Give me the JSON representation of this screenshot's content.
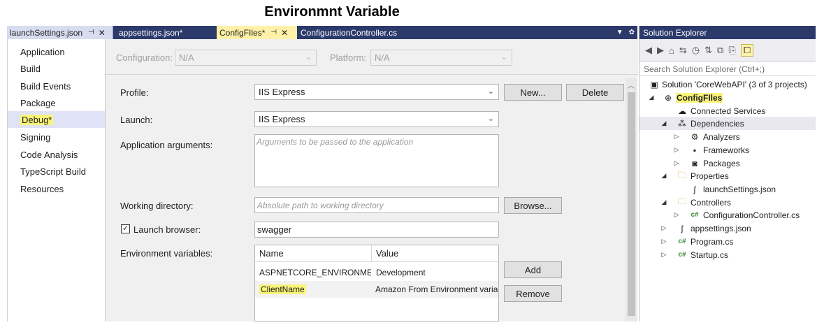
{
  "page_title": "Environmnt Variable",
  "tabs": [
    {
      "label": "launchSettings.json",
      "pin": "⊣",
      "close": "✕"
    },
    {
      "label": "appsettings.json*"
    },
    {
      "label": "ConfigFIles*",
      "pin": "⊣",
      "close": "✕"
    },
    {
      "label": "ConfigurationController.cs"
    }
  ],
  "tab_controls": {
    "dropdown": "▼",
    "gear": "✿"
  },
  "left_nav": [
    "Application",
    "Build",
    "Build Events",
    "Package",
    "Debug*",
    "Signing",
    "Code Analysis",
    "TypeScript Build",
    "Resources"
  ],
  "config": {
    "configuration_label": "Configuration:",
    "configuration_value": "N/A",
    "platform_label": "Platform:",
    "platform_value": "N/A"
  },
  "debug": {
    "profile_label": "Profile:",
    "profile_value": "IIS Express",
    "new_button": "New...",
    "delete_button": "Delete",
    "launch_label": "Launch:",
    "launch_value": "IIS Express",
    "app_args_label": "Application arguments:",
    "app_args_placeholder": "Arguments to be passed to the application",
    "working_dir_label": "Working directory:",
    "working_dir_placeholder": "Absolute path to working directory",
    "browse_button": "Browse...",
    "launch_browser_label": "Launch browser:",
    "launch_browser_checked": "✓",
    "launch_browser_value": "swagger",
    "env_label": "Environment variables:",
    "env_headers": [
      "Name",
      "Value"
    ],
    "env_rows": [
      {
        "name": "ASPNETCORE_ENVIRONMENT",
        "value": "Development"
      },
      {
        "name": "ClientName",
        "value": "Amazon From Environment variable"
      }
    ],
    "add_button": "Add",
    "remove_button": "Remove"
  },
  "solution_explorer": {
    "title": "Solution Explorer",
    "search_placeholder": "Search Solution Explorer (Ctrl+;)",
    "toolbar_icons": [
      "◀",
      "▶",
      "⌂",
      "⇆",
      "◷",
      "⇅",
      "⧉",
      "⎘",
      "⧠"
    ],
    "tree": [
      {
        "label": "Solution 'CoreWebAPI' (3 of 3 projects)",
        "expander": "",
        "icon": "▣"
      },
      {
        "label": "ConfigFIles",
        "expander": "◢",
        "icon": "⊕"
      },
      {
        "label": "Connected Services",
        "expander": "",
        "icon": "☁"
      },
      {
        "label": "Dependencies",
        "expander": "◢",
        "icon": "⁂"
      },
      {
        "label": "Analyzers",
        "expander": "▷",
        "icon": "⚙"
      },
      {
        "label": "Frameworks",
        "expander": "▷",
        "icon": "▪"
      },
      {
        "label": "Packages",
        "expander": "▷",
        "icon": "◙"
      },
      {
        "label": "Properties",
        "expander": "◢",
        "icon": "🗀"
      },
      {
        "label": "launchSettings.json",
        "expander": "",
        "icon": "ʃ"
      },
      {
        "label": "Controllers",
        "expander": "◢",
        "icon": "🗀"
      },
      {
        "label": "ConfigurationController.cs",
        "expander": "▷",
        "icon": "c#"
      },
      {
        "label": "appsettings.json",
        "expander": "▷",
        "icon": "ʃ"
      },
      {
        "label": "Program.cs",
        "expander": "▷",
        "icon": "c#"
      },
      {
        "label": "Startup.cs",
        "expander": "▷",
        "icon": "c#"
      }
    ]
  },
  "colors": {
    "tab_bar": "#2b3a6b",
    "highlight": "#f9f47a",
    "active_tab": "#fff1a8"
  }
}
